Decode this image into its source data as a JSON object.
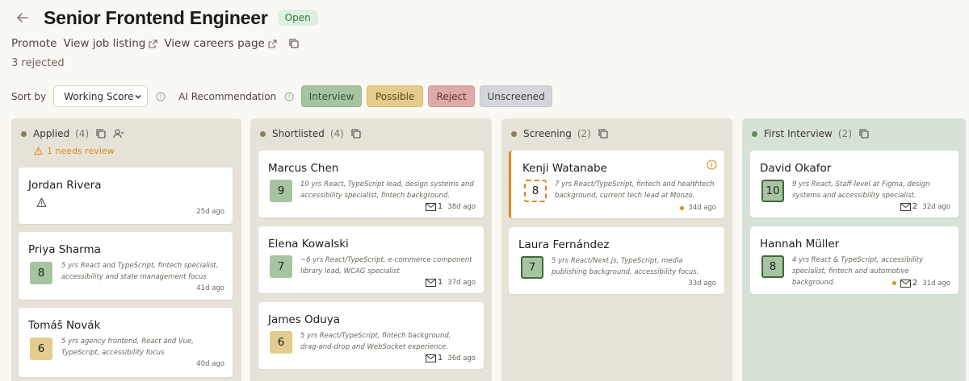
{
  "header": {
    "title": "Senior Frontend Engineer",
    "status": "Open"
  },
  "links": {
    "promote": "Promote",
    "view_job": "View job listing",
    "view_careers": "View careers page"
  },
  "rejected_text": "3 rejected",
  "toolbar": {
    "sort_label": "Sort by",
    "sort_value": "Working Score",
    "ai_label": "AI Recommendation",
    "filters": [
      "Interview",
      "Possible",
      "Reject",
      "Unscreened"
    ]
  },
  "colors": {
    "accent": "#e08a1e",
    "green": "#a7c4a0",
    "yellow": "#e3cc8e",
    "red": "#deaaa8",
    "gray": "#d5d6dc"
  },
  "columns": [
    {
      "title": "Applied",
      "count": "(4)",
      "review": "1 needs review",
      "dot": "#8b7c5a",
      "cards": [
        {
          "name": "Jordan Rivera",
          "age": "25d ago"
        },
        {
          "name": "Priya Sharma",
          "score": "8",
          "desc": "5 yrs React and TypeScript, fintech specialist, accessibility and state management focus",
          "age": "41d ago"
        },
        {
          "name": "Tomáš Novák",
          "score": "6",
          "desc": "5 yrs agency frontend, React and Vue, TypeScript, accessibility focus",
          "age": "40d ago"
        }
      ]
    },
    {
      "title": "Shortlisted",
      "count": "(4)",
      "dot": "#8b7c5a",
      "cards": [
        {
          "name": "Marcus Chen",
          "score": "9",
          "desc": "10 yrs React, TypeScript lead, design systems and accessibility specialist, fintech background.",
          "mail": "1",
          "age": "38d ago"
        },
        {
          "name": "Elena Kowalski",
          "score": "7",
          "desc": "~6 yrs React/TypeScript, e-commerce component library lead, WCAG specialist",
          "mail": "1",
          "age": "37d ago"
        },
        {
          "name": "James Oduya",
          "score": "6",
          "desc": "5 yrs React/TypeScript, fintech background, drag-and-drop and WebSocket experience.",
          "mail": "1",
          "age": "36d ago"
        }
      ]
    },
    {
      "title": "Screening",
      "count": "(2)",
      "dot": "#8b7c5a",
      "cards": [
        {
          "name": "Kenji Watanabe",
          "score": "8",
          "desc": "7 yrs React/TypeScript, fintech and healthtech background, current tech lead at Monzo.",
          "age": "34d ago"
        },
        {
          "name": "Laura Fernández",
          "score": "7",
          "desc": "5 yrs React/Next.js, TypeScript, media publishing background, accessibility focus.",
          "age": "33d ago"
        }
      ]
    },
    {
      "title": "First Interview",
      "count": "(2)",
      "dot": "#5b8a5e",
      "cards": [
        {
          "name": "David Okafor",
          "score": "10",
          "desc": "9 yrs React, Staff-level at Figma, design systems and accessibility specialist.",
          "mail": "2",
          "age": "32d ago"
        },
        {
          "name": "Hannah Müller",
          "score": "8",
          "desc": "4 yrs React & TypeScript, accessibility specialist, fintech and automotive background.",
          "mail": "2",
          "age": "31d ago"
        }
      ]
    }
  ]
}
